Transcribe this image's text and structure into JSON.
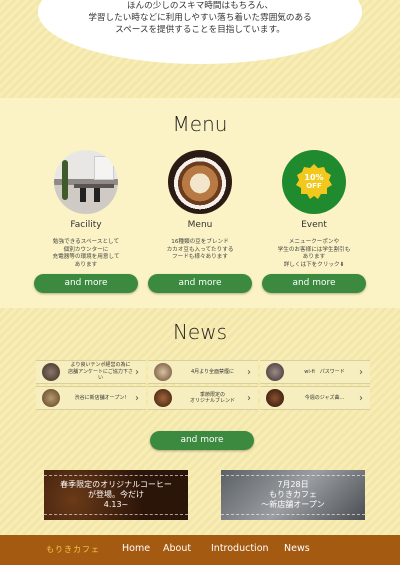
{
  "intro": {
    "lines": [
      "ほんの少しのスキマ時間はもちろん、",
      "学習したい時などに利用しやすい落ち着いた雰囲気のある",
      "スペースを提供することを目指しています。"
    ]
  },
  "menu": {
    "title": "Menu",
    "items": [
      {
        "label": "Facility",
        "desc": [
          "勉強できるスペースとして",
          "個別カウンターに",
          "充電器等の環境を用意して",
          "あります"
        ],
        "button": "and more",
        "icon": "facility-photo"
      },
      {
        "label": "Menu",
        "desc": [
          "16種類の豆をブレンド",
          "カカオ豆も入ってたりする",
          "フードも様々あります"
        ],
        "button": "and more",
        "icon": "latte-photo"
      },
      {
        "label": "Event",
        "desc": [
          "メニュークーポンや",
          "学生のお客様には学生割引も",
          "あります",
          "詳しくは下をクリック⬇"
        ],
        "button": "and more",
        "icon": "discount-badge",
        "badge_top": "10%",
        "badge_bottom": "OFF"
      }
    ]
  },
  "news": {
    "title": "News",
    "items": [
      [
        "より良いテンポ経営の為に",
        "店舗アンケートにご協力下さい"
      ],
      [
        "4月より全面禁煙に"
      ],
      [
        "wi-fi　パスワード"
      ],
      [
        "渋谷に新店舗オープン!"
      ],
      [
        "季節限定の",
        "オリジナルブレンド"
      ],
      [
        "今週のジャズ曲..."
      ]
    ],
    "more_button": "and more"
  },
  "banners": [
    {
      "lines": [
        "春季限定のオリジナルコーヒー",
        "が登場。今だけ",
        "4.13~"
      ]
    },
    {
      "lines": [
        "7月28日",
        "もりきカフェ",
        "〜新店舗オープン"
      ]
    }
  ],
  "footer": {
    "logo": "もりきカフェ",
    "nav": [
      "Home",
      "About",
      "Introduction",
      "News"
    ]
  },
  "colors": {
    "accent_green": "#3c8a3f",
    "footer_brown": "#a55a12",
    "badge_yellow": "#f2c81c"
  }
}
